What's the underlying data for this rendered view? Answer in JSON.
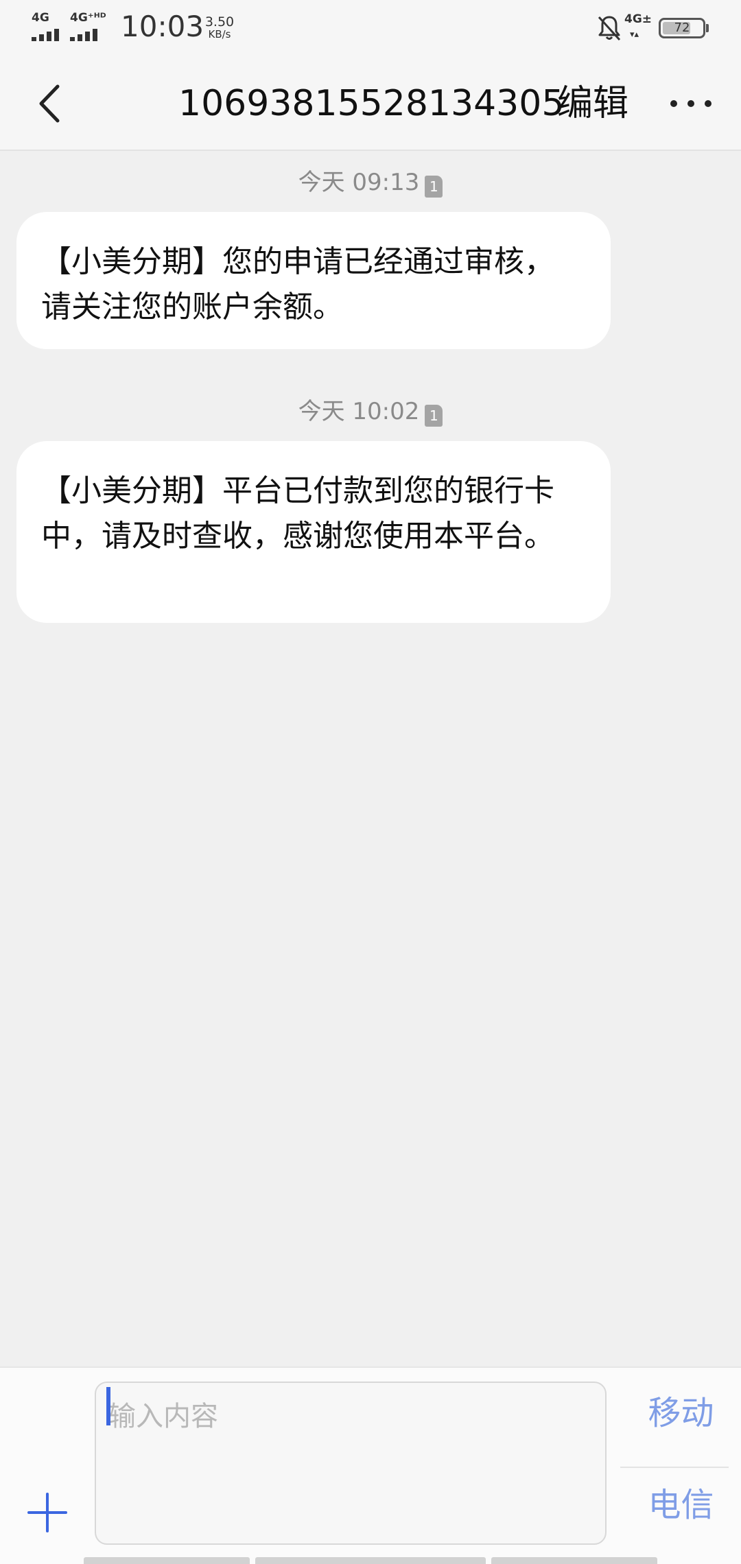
{
  "status_bar": {
    "network_1": "4G",
    "network_2": "4G⁺ᴴᴰ",
    "time": "10:03",
    "speed_value": "3.50",
    "speed_unit": "KB/s",
    "network_3": "4G±",
    "network_3_sub": "▾▴",
    "battery_level": "72",
    "battery_fraction": 0.72
  },
  "header": {
    "back_icon": "chevron-left-icon",
    "title": "10693815528134305",
    "edit_label": "编辑",
    "more_icon": "more-horizontal-icon"
  },
  "messages": [
    {
      "timestamp": "今天 09:13",
      "sim_label": "1",
      "text": "【小美分期】您的申请已经通过审核，请关注您的账户余额。"
    },
    {
      "timestamp": "今天 10:02",
      "sim_label": "1",
      "text": "【小美分期】平台已付款到您的银行卡中，请及时查收，感谢您使用本平台。"
    }
  ],
  "composer": {
    "add_icon": "plus-icon",
    "placeholder": "输入内容",
    "value": "",
    "send_mobile_label": "移动",
    "send_telecom_label": "电信"
  },
  "colors": {
    "accent": "#3b66e0",
    "send_text": "#7f9de6",
    "background": "#f0f0f0",
    "bubble": "#ffffff"
  }
}
